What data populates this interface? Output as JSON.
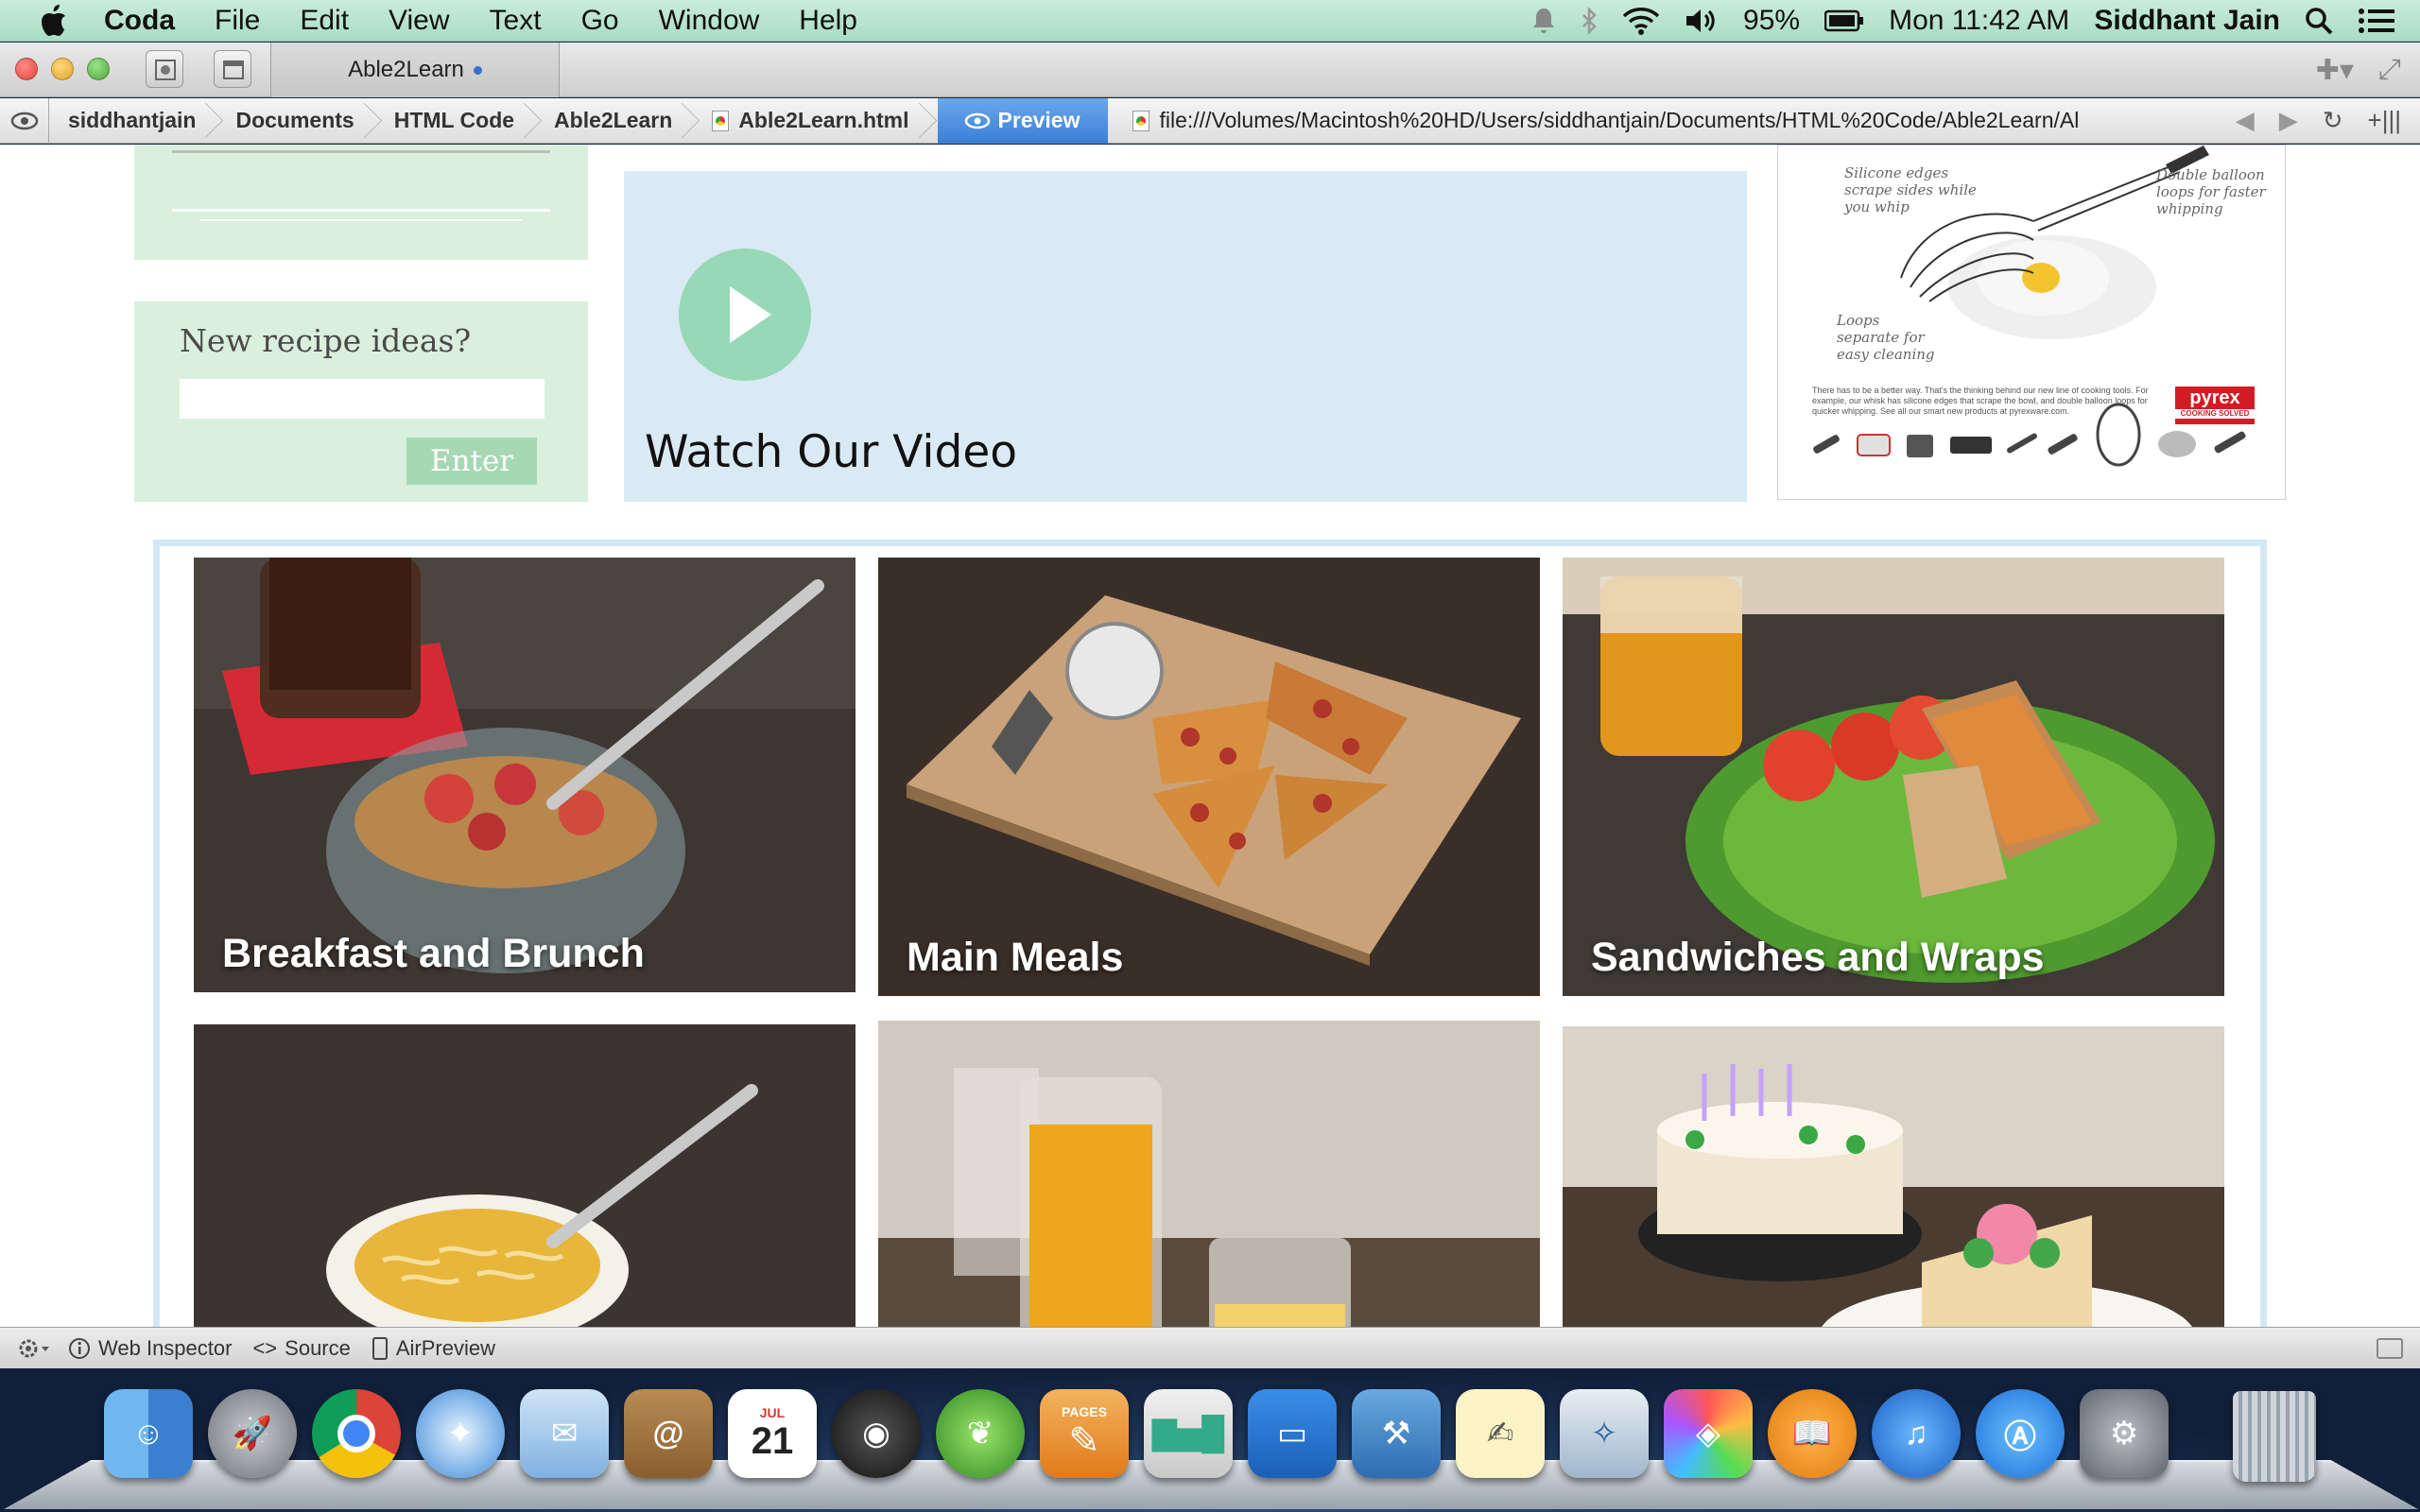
{
  "menubar": {
    "app_name": "Coda",
    "items": [
      "File",
      "Edit",
      "View",
      "Text",
      "Go",
      "Window",
      "Help"
    ],
    "battery": "95%",
    "clock": "Mon 11:42 AM",
    "user": "Siddhant Jain"
  },
  "window": {
    "tab_title": "Able2Learn"
  },
  "pathbar": {
    "crumbs": [
      "siddhantjain",
      "Documents",
      "HTML Code",
      "Able2Learn",
      "Able2Learn.html"
    ],
    "preview_label": "Preview",
    "url": "file:///Volumes/Macintosh%20HD/Users/siddhantjain/Documents/HTML%20Code/Able2Learn/Al"
  },
  "page": {
    "recipe_box": {
      "title": "New recipe ideas?",
      "input_value": "",
      "enter_label": "Enter"
    },
    "video": {
      "title": "Watch Our Video"
    },
    "ad": {
      "note_left": "Silicone edges scrape sides while you whip",
      "note_right": "Double balloon loops for faster whipping",
      "note_bottom": "Loops separate for easy cleaning",
      "copy": "There has to be a better way. That's the thinking behind our new line of cooking tools. For example, our whisk has silicone edges that scrape the bowl, and double balloon loops for quicker whipping. See all our smart new products at pyrexware.com.",
      "brand": "pyrex",
      "tagline": "COOKING SOLVED"
    },
    "categories": [
      {
        "label": "Breakfast and Brunch"
      },
      {
        "label": "Main Meals"
      },
      {
        "label": "Sandwiches and Wraps"
      },
      {
        "label": ""
      },
      {
        "label": ""
      },
      {
        "label": ""
      }
    ]
  },
  "inspector_bar": {
    "web_inspector": "Web Inspector",
    "source": "Source",
    "airpreview": "AirPreview"
  },
  "dock": {
    "calendar_month": "JUL",
    "calendar_day": "21",
    "pages_label": "PAGES",
    "icons": [
      "finder-icon",
      "launchpad-icon",
      "chrome-icon",
      "safari-icon",
      "mail-icon",
      "contacts-icon",
      "calendar-icon",
      "facetime-icon",
      "coda-icon",
      "pages-icon",
      "numbers-icon",
      "keynote-icon",
      "xcode-icon",
      "textedit-icon",
      "preview-icon",
      "grapher-icon",
      "ibooks-icon",
      "itunes-icon",
      "app-store-icon",
      "system-preferences-icon",
      "trash-icon"
    ]
  },
  "colors": {
    "menubar": "#b8e4d0",
    "box_green": "#daf0dd",
    "video_blue": "#d9eaf4",
    "play_green": "#97d8b6",
    "frame_blue": "#d3e8f5",
    "preview_blue": "#4a8edf"
  }
}
